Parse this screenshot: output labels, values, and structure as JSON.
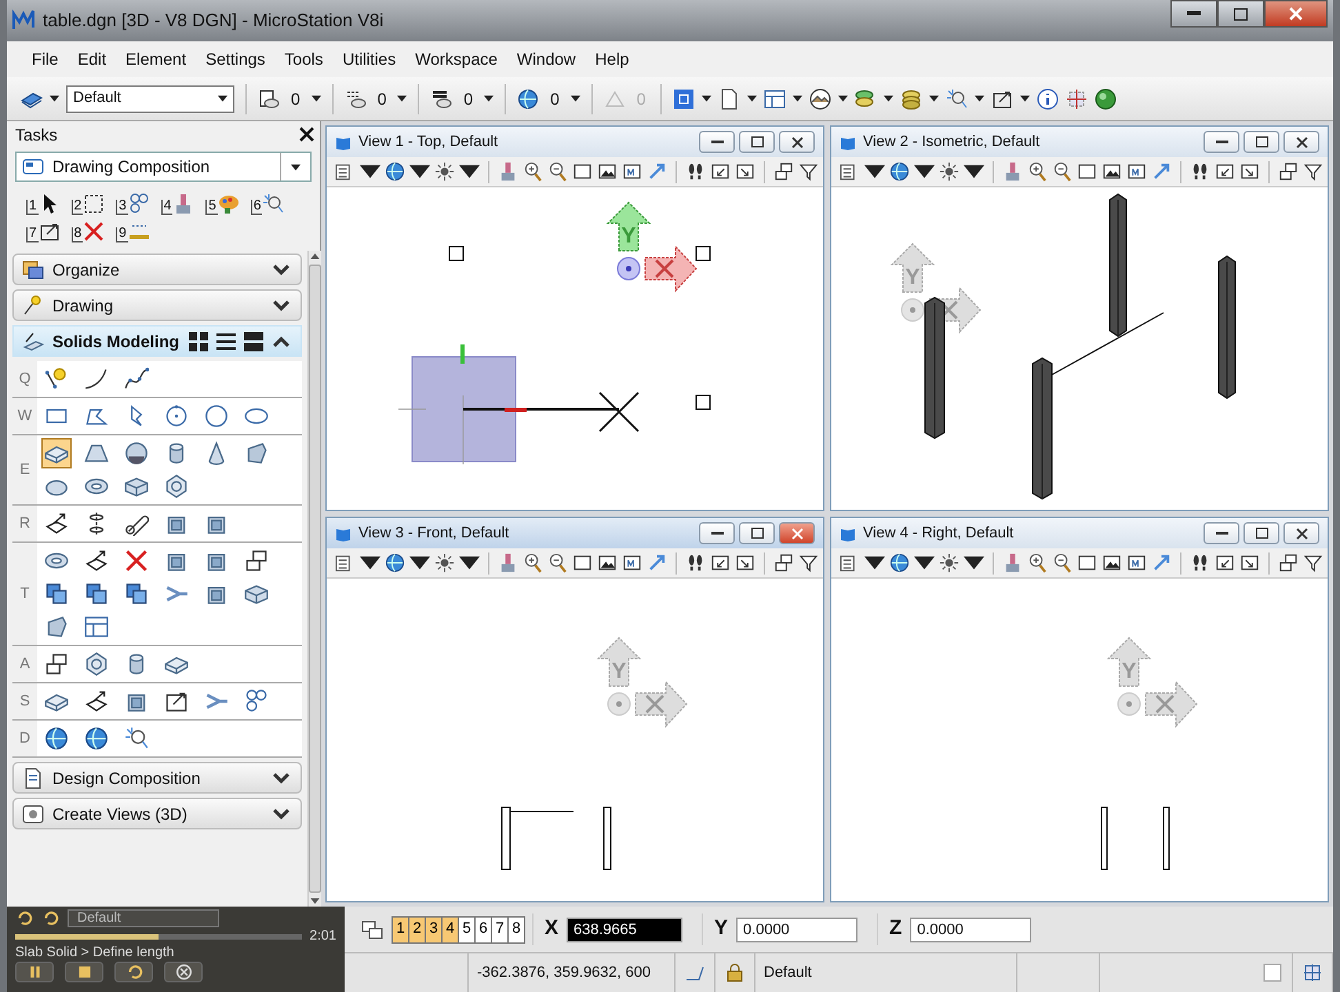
{
  "window": {
    "title": "table.dgn [3D - V8 DGN] - MicroStation V8i"
  },
  "menu": [
    "File",
    "Edit",
    "Element",
    "Settings",
    "Tools",
    "Utilities",
    "Workspace",
    "Window",
    "Help"
  ],
  "attributes_toolbar": {
    "active_level": "Default",
    "fields": [
      {
        "value": "0",
        "disabled": false
      },
      {
        "value": "0",
        "disabled": false
      },
      {
        "value": "0",
        "disabled": false
      },
      {
        "value": "0",
        "disabled": false
      },
      {
        "value": "0",
        "disabled": true
      }
    ]
  },
  "tasks": {
    "title": "Tasks",
    "task_set": "Drawing Composition",
    "main_tools": [
      "1",
      "2",
      "3",
      "4",
      "5",
      "6",
      "7",
      "8",
      "9"
    ],
    "sections": [
      {
        "label": "Organize",
        "expanded": false
      },
      {
        "label": "Drawing",
        "expanded": false
      },
      {
        "label": "Solids Modeling",
        "expanded": true,
        "groups": [
          {
            "key": "Q",
            "tools": [
              {
                "selected": false
              },
              {
                "selected": false
              },
              {
                "selected": false
              }
            ]
          },
          {
            "key": "W",
            "tools": [
              {
                "selected": false
              },
              {
                "selected": false
              },
              {
                "selected": false
              },
              {
                "selected": false
              },
              {
                "selected": false
              },
              {
                "selected": false
              }
            ]
          },
          {
            "key": "E",
            "tools": [
              {
                "selected": true
              },
              {
                "selected": false
              },
              {
                "selected": false
              },
              {
                "selected": false
              },
              {
                "selected": false
              },
              {
                "selected": false
              },
              {
                "selected": false
              },
              {
                "selected": false
              },
              {
                "selected": false
              },
              {
                "selected": false
              }
            ]
          },
          {
            "key": "R",
            "tools": [
              {
                "selected": false
              },
              {
                "selected": false
              },
              {
                "selected": false
              },
              {
                "selected": false
              },
              {
                "selected": false
              }
            ]
          },
          {
            "key": "T",
            "tools": [
              {
                "selected": false
              },
              {
                "selected": false
              },
              {
                "selected": false
              },
              {
                "selected": false
              },
              {
                "selected": false
              },
              {
                "selected": false
              },
              {
                "selected": false
              },
              {
                "selected": false
              },
              {
                "selected": false
              },
              {
                "selected": false
              },
              {
                "selected": false
              },
              {
                "selected": false
              },
              {
                "selected": false
              },
              {
                "selected": false
              }
            ]
          },
          {
            "key": "A",
            "tools": [
              {
                "selected": false
              },
              {
                "selected": false
              },
              {
                "selected": false
              },
              {
                "selected": false
              }
            ]
          },
          {
            "key": "S",
            "tools": [
              {
                "selected": false
              },
              {
                "selected": false
              },
              {
                "selected": false
              },
              {
                "selected": false
              },
              {
                "selected": false
              },
              {
                "selected": false
              }
            ]
          },
          {
            "key": "D",
            "tools": [
              {
                "selected": false
              },
              {
                "selected": false
              },
              {
                "selected": false
              }
            ]
          }
        ]
      },
      {
        "label": "Design Composition",
        "expanded": false
      },
      {
        "label": "Create Views (3D)",
        "expanded": false
      }
    ]
  },
  "views": [
    {
      "title": "View 1 - Top, Default",
      "kind": "top",
      "selected": false,
      "axis_label": "Y"
    },
    {
      "title": "View 2 - Isometric, Default",
      "kind": "iso",
      "selected": false,
      "axis_label": "Y"
    },
    {
      "title": "View 3 - Front, Default",
      "kind": "front",
      "selected": true,
      "axis_label": "Y"
    },
    {
      "title": "View 4 - Right, Default",
      "kind": "right",
      "selected": false,
      "axis_label": "Y"
    }
  ],
  "player": {
    "time": "2:01",
    "level": 0.5,
    "active_level": "Default"
  },
  "view_toggles": [
    {
      "label": "1",
      "on": true
    },
    {
      "label": "2",
      "on": true
    },
    {
      "label": "3",
      "on": true
    },
    {
      "label": "4",
      "on": true
    },
    {
      "label": "5",
      "on": false
    },
    {
      "label": "6",
      "on": false
    },
    {
      "label": "7",
      "on": false
    },
    {
      "label": "8",
      "on": false
    }
  ],
  "coordinates": [
    {
      "axis": "X",
      "value": "638.9665",
      "selected": true
    },
    {
      "axis": "Y",
      "value": "0.0000",
      "selected": false
    },
    {
      "axis": "Z",
      "value": "0.0000",
      "selected": false
    }
  ],
  "status_bar": {
    "prompt": "Slab Solid > Define length",
    "position": "-362.3876, 359.9632, 600",
    "active_level": "Default"
  }
}
